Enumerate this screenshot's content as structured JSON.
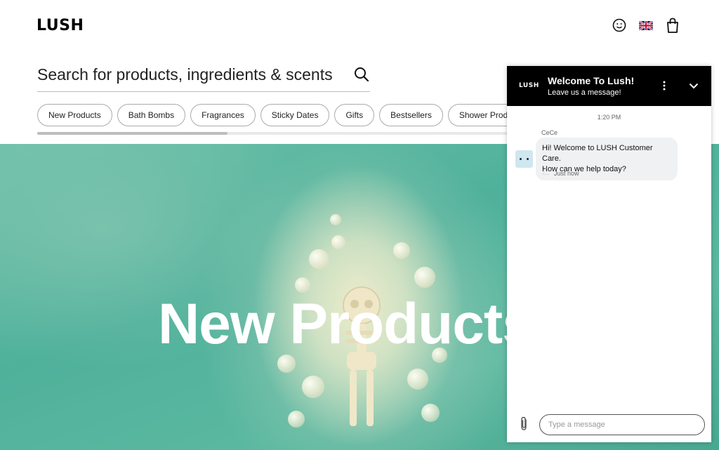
{
  "header": {
    "logo": "LUSH",
    "icons": [
      "account-icon",
      "uk-flag-icon",
      "bag-icon"
    ]
  },
  "search": {
    "placeholder": "Search for products, ingredients & scents",
    "icon": "search-icon"
  },
  "categories": [
    "New Products",
    "Bath Bombs",
    "Fragrances",
    "Sticky Dates",
    "Gifts",
    "Bestsellers",
    "Shower Products"
  ],
  "hero": {
    "title": "New Products"
  },
  "chat": {
    "logo": "LUSH",
    "title": "Welcome To Lush!",
    "subtitle": "Leave us a message!",
    "time": "1:20 PM",
    "agent_name": "CeCe",
    "message_line1": "Hi! Welcome to LUSH Customer Care.",
    "message_line2": "How can we help today?",
    "message_meta": "Just now",
    "input_placeholder": "Type a message"
  },
  "colors": {
    "chat_header": "#000000",
    "hero_teal": "#55b59d",
    "bubble_bg": "#f0f1f3"
  }
}
